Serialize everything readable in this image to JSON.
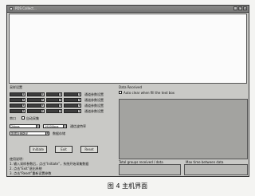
{
  "window": {
    "title": "PDS Collect...",
    "minimize_glyph": "_",
    "maximize_glyph": "□",
    "close_glyph": "×"
  },
  "left_panel": {
    "section_label": "采样设置",
    "rows": [
      {
        "combos": [
          "",
          "",
          "",
          ""
        ],
        "label": "通道参数设置"
      },
      {
        "combos": [
          "",
          "",
          "",
          ""
        ],
        "label": "通道参数设置"
      },
      {
        "combos": [
          "",
          "",
          "",
          ""
        ],
        "label": "通道参数设置"
      },
      {
        "combos": [
          "",
          "",
          "",
          ""
        ],
        "label": "通道参数设置"
      }
    ],
    "port_label": "串口",
    "checkbox_label": "自动采集",
    "speed_combo": "2kbps",
    "rate_combo": "19200bps",
    "rate_label": "通信波特率",
    "path_combo": "数据存储路径",
    "path_label": "数据存储",
    "buttons": {
      "initiate": "Initiate",
      "exit": "Exit",
      "reset": "Reset"
    },
    "notes_label": "使用说明：",
    "notes": [
      "1. 输入采样参数后，点击“Initiate”，系统开始采集数据",
      "2. 点击“Exit”退出系统",
      "3. 点击“Reset”重新设置参数"
    ]
  },
  "right_panel": {
    "section_label": "Data Received",
    "checkbox_label": "Auto clear when fill the text box",
    "status_left_label": "Total groups received / data",
    "status_right_label": "Max time between data"
  },
  "caption": "图 4   主机界面"
}
